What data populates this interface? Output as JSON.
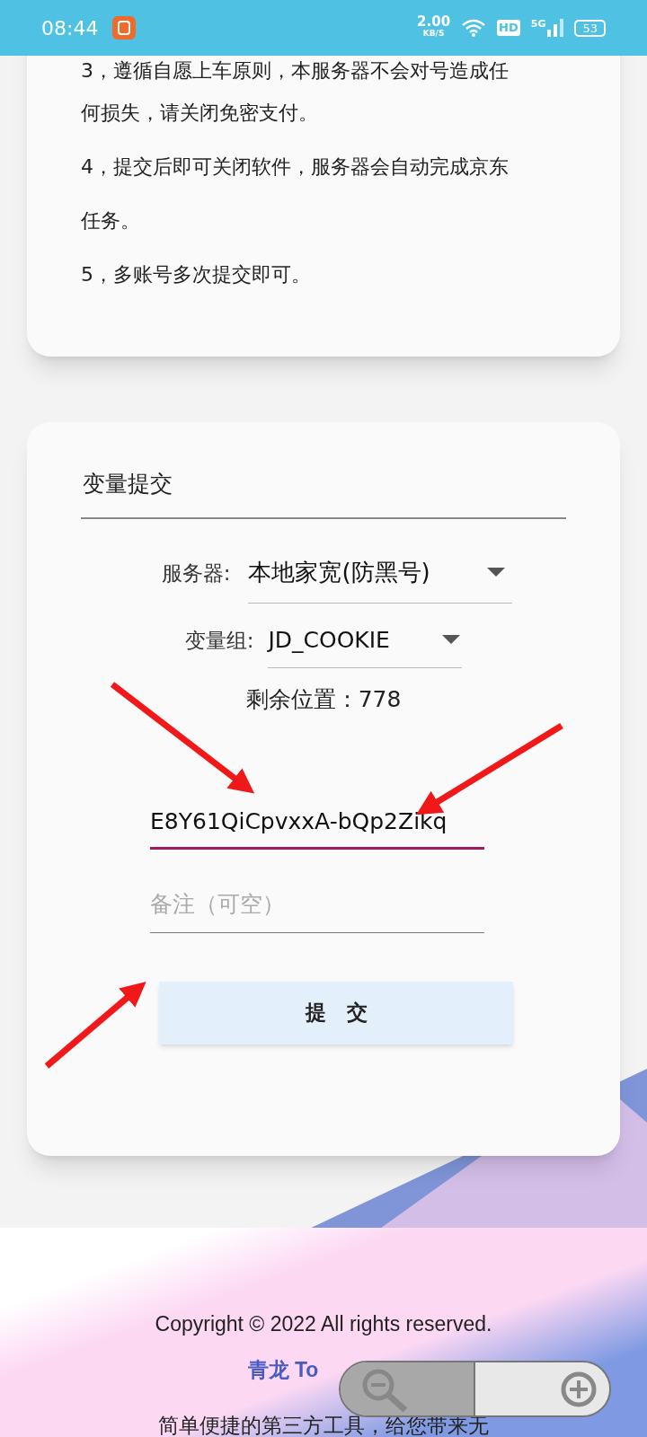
{
  "status_bar": {
    "time": "08:44",
    "speed": "2.00",
    "speed_unit": "KB/S",
    "hd": "HD",
    "network": "5G",
    "battery": "53"
  },
  "notes": [
    "3，遵循自愿上车原则，本服务器不会对号造成任",
    "何损失，请关闭免密支付。",
    "4，提交后即可关闭软件，服务器会自动完成京东",
    "任务。",
    "5，多账号多次提交即可。"
  ],
  "form": {
    "title": "变量提交",
    "server_label": "服务器:",
    "server_value": "本地家宽(防黑号)",
    "group_label": "变量组:",
    "group_value": "JD_COOKIE",
    "remaining": "剩余位置：778",
    "cookie_value": "E8Y61QiCpvxxA-bQp2Zikq",
    "remark_placeholder": "备注（可空）",
    "submit": "提　交"
  },
  "footer": {
    "copyright": "Copyright © 2022 All rights reserved.",
    "link": "青龙 To",
    "tagline": "简单便捷的第三方工具，给您带来无"
  }
}
